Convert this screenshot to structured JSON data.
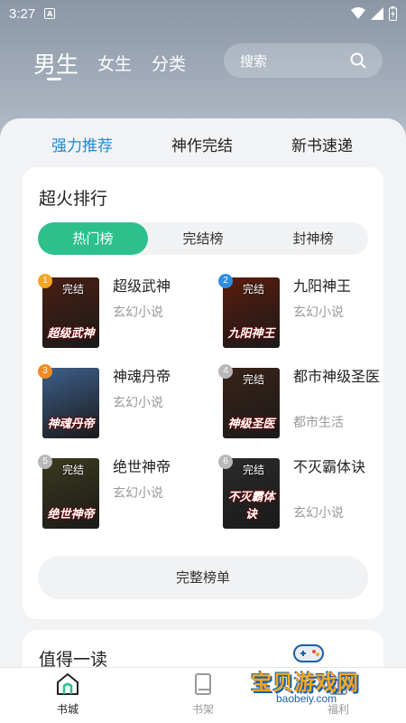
{
  "status": {
    "time": "3:27",
    "indicator": "A"
  },
  "header": {
    "tabs": [
      "男生",
      "女生",
      "分类"
    ],
    "active_tab": "男生",
    "search_placeholder": "搜索"
  },
  "sections": {
    "tabs": [
      "强力推荐",
      "神作完结",
      "新书速递"
    ],
    "active": "强力推荐"
  },
  "ranking": {
    "title": "超火排行",
    "tabs": [
      "热门榜",
      "完结榜",
      "封神榜"
    ],
    "active_tab": "热门榜",
    "books": [
      {
        "rank": "1",
        "name": "超级武神",
        "genre": "玄幻小说",
        "tag": "完结",
        "cover_text": "超级武神",
        "badge_color": "#f5a623",
        "cover_color": "#4a1f12"
      },
      {
        "rank": "2",
        "name": "九阳神王",
        "genre": "玄幻小说",
        "tag": "完结",
        "cover_text": "九阳神王",
        "badge_color": "#2e8fe0",
        "cover_color": "#5a1c0c"
      },
      {
        "rank": "3",
        "name": "神魂丹帝",
        "genre": "玄幻小说",
        "tag": "",
        "cover_text": "神魂丹帝",
        "badge_color": "#f08a24",
        "cover_color": "#3d5f8a"
      },
      {
        "rank": "4",
        "name": "都市神级圣医",
        "genre": "都市生活",
        "tag": "完结",
        "cover_text": "神级圣医",
        "badge_color": "#b8b8b8",
        "cover_color": "#3a2318"
      },
      {
        "rank": "5",
        "name": "绝世神帝",
        "genre": "玄幻小说",
        "tag": "完结",
        "cover_text": "绝世神帝",
        "badge_color": "#b8b8b8",
        "cover_color": "#3b3a1e"
      },
      {
        "rank": "6",
        "name": "不灭霸体诀",
        "genre": "玄幻小说",
        "tag": "完结",
        "cover_text": "不灭霸体诀",
        "badge_color": "#b8b8b8",
        "cover_color": "#2a2a2a"
      }
    ],
    "full_list_button": "完整榜单"
  },
  "worth_reading": {
    "title": "值得一读"
  },
  "bottom_nav": {
    "items": [
      {
        "label": "书城",
        "icon": "store-icon"
      },
      {
        "label": "书架",
        "icon": "bookshelf-icon"
      },
      {
        "label": "福利",
        "icon": "gift-icon"
      }
    ],
    "active": "书城"
  },
  "watermark": {
    "main": "宝贝游戏网",
    "url": "baobeiy.com",
    "accent": "#f5a623"
  },
  "colors": {
    "accent_green": "#2dc08d",
    "accent_blue": "#1f8ad0"
  }
}
